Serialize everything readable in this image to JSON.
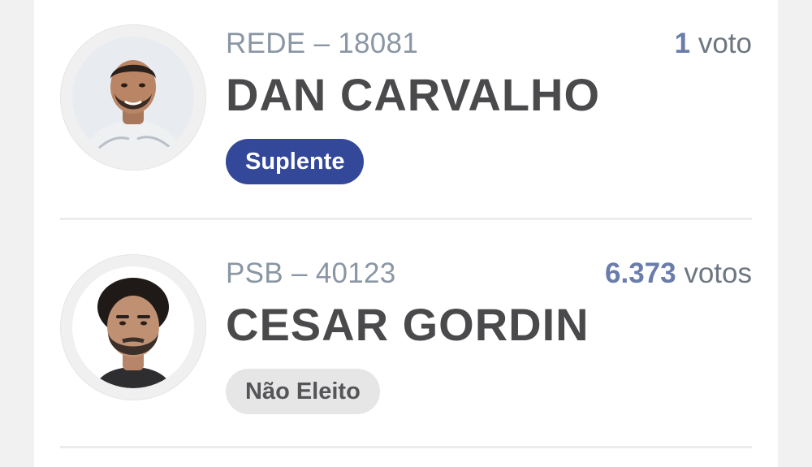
{
  "candidates": [
    {
      "party_number": "REDE – 18081",
      "name": "DAN CARVALHO",
      "votes_number": "1",
      "votes_label": "voto",
      "status": "Suplente",
      "status_color": "#34489a"
    },
    {
      "party_number": "PSB – 40123",
      "name": "CESAR GORDIN",
      "votes_number": "6.373",
      "votes_label": "votos",
      "status": "Não Eleito",
      "status_color": "#e6e6e7"
    }
  ],
  "colors": {
    "vote_number": "#6a7cab",
    "party_text": "#8a96a3",
    "name_text": "#4a4a4c"
  }
}
